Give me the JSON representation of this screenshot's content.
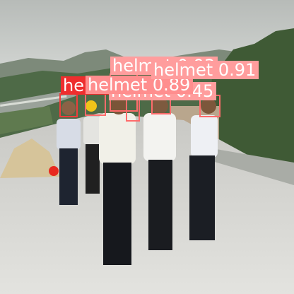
{
  "detections": [
    {
      "label": "helmet 0.93",
      "color": "#ff9d9d"
    },
    {
      "label": "helmet 0.91",
      "color": "#ff9d9d"
    },
    {
      "label": "helmet 0.89",
      "color": "#ff8e8e"
    },
    {
      "label": "helmet 0.45",
      "color": "#ff9d9d"
    },
    {
      "label": "helmet",
      "color": "#ff9d9d"
    },
    {
      "label": "helmet",
      "color": "#ee2e2e"
    }
  ],
  "colors": {
    "box": "#ff6b6b",
    "box_dark": "#f03c3c",
    "label_text": "#ffffff"
  }
}
